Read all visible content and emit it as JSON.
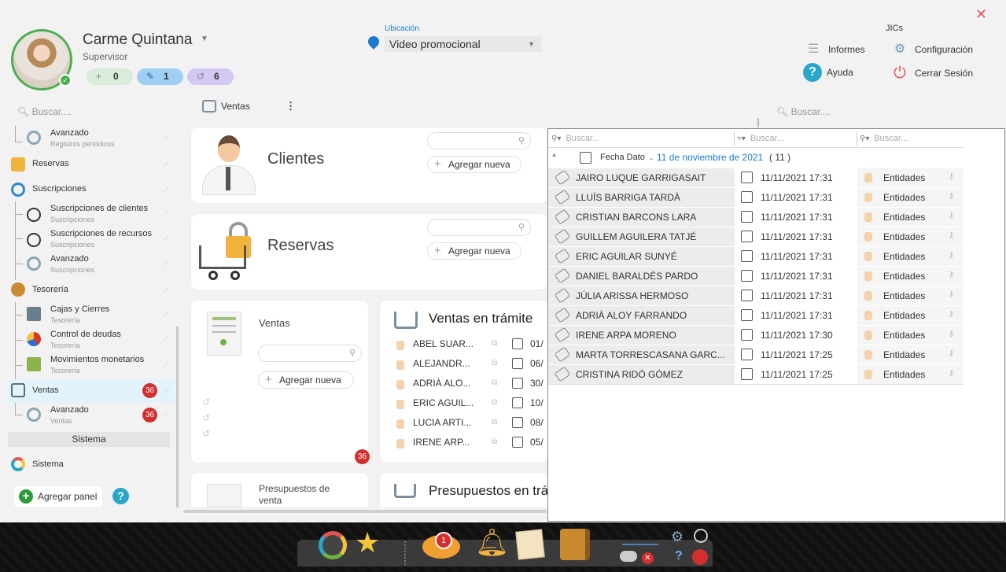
{
  "window": {
    "close_glyph": "✕"
  },
  "user": {
    "name": "Carme Quintana",
    "role": "Supervisor",
    "counters": [
      {
        "icon": "plus-icon",
        "value": "0",
        "color": "#d8ecd9"
      },
      {
        "icon": "pencil-icon",
        "value": "1",
        "color": "#9fcff2"
      },
      {
        "icon": "history-icon",
        "value": "6",
        "color": "#d2c8f2"
      }
    ]
  },
  "location": {
    "label": "Ubicación",
    "value": "Video promocional"
  },
  "header": {
    "jics_label": "JICs",
    "buttons": [
      {
        "id": "informes",
        "label": "Informes",
        "icon": "report-icon"
      },
      {
        "id": "configuracion",
        "label": "Configuración",
        "icon": "gear-icon"
      },
      {
        "id": "ayuda",
        "label": "Ayuda",
        "icon": "help-icon"
      },
      {
        "id": "cerrar",
        "label": "Cerrar Sesión",
        "icon": "power-icon"
      }
    ]
  },
  "sidebar": {
    "search_placeholder": "Buscar....",
    "items": [
      {
        "label": "Avanzado",
        "sub": "Registros periódicos",
        "icon": "gear-icon",
        "child": true
      },
      {
        "label": "Reservas",
        "sub": "",
        "icon": "cart-lock-icon",
        "child": false
      },
      {
        "label": "Suscripciones",
        "sub": "",
        "icon": "subscription-icon",
        "child": false
      },
      {
        "label": "Suscripciones de clientes",
        "sub": "Suscripciones",
        "icon": "client-subscription-icon",
        "child": true
      },
      {
        "label": "Suscripciones de recursos",
        "sub": "Suscripciones",
        "icon": "resource-subscription-icon",
        "child": true
      },
      {
        "label": "Avanzado",
        "sub": "Suscripciones",
        "icon": "gear-icon",
        "child": true
      },
      {
        "label": "Tesorería",
        "sub": "",
        "icon": "money-bag-icon",
        "child": false
      },
      {
        "label": "Cajas y Cierres",
        "sub": "Tesorería",
        "icon": "cash-register-icon",
        "child": true
      },
      {
        "label": "Control de deudas",
        "sub": "Tesorería",
        "icon": "pie-chart-icon",
        "child": true
      },
      {
        "label": "Movimientos monetarios",
        "sub": "Tesorería",
        "icon": "money-movement-icon",
        "child": true
      },
      {
        "label": "Ventas",
        "sub": "",
        "icon": "cart-icon",
        "child": false,
        "badge": "36"
      },
      {
        "label": "Avanzado",
        "sub": "Ventas",
        "icon": "gear-icon",
        "child": true,
        "badge": "36"
      }
    ],
    "section_header": "Sistema",
    "sistema_item": "Sistema",
    "add_panel": "Agregar panel",
    "help_glyph": "?"
  },
  "main": {
    "tab_label": "Ventas",
    "kebab": "⋮",
    "cards": {
      "clientes": {
        "title": "Clientes",
        "add_label": "Agregar nueva"
      },
      "reservas": {
        "title": "Reservas",
        "add_label": "Agregar nueva"
      },
      "ventas": {
        "title": "Ventas",
        "add_label": "Agregar nueva",
        "badge": "36"
      },
      "ventas_tramite": {
        "title": "Ventas en trámite",
        "rows": [
          {
            "name": "ABEL SUAR...",
            "date": "01/"
          },
          {
            "name": "ALEJANDR...",
            "date": "06/"
          },
          {
            "name": "ADRIÀ ALO...",
            "date": "30/"
          },
          {
            "name": "ERIC AGUIL...",
            "date": "10/"
          },
          {
            "name": "LUCIA ARTI...",
            "date": "08/"
          },
          {
            "name": "IRENE ARP...",
            "date": "05/"
          }
        ]
      },
      "presupuestos": {
        "title": "Presupuestos de venta"
      },
      "presupuestos_tramite": {
        "title": "Presupuestos en trá"
      }
    },
    "right_search_placeholder": "Buscar...."
  },
  "grid": {
    "filter_placeholders": [
      "Buscar...",
      "Buscar...",
      "Buscar..."
    ],
    "group": {
      "field": "Fecha Dato",
      "dash": "-",
      "date": "11 de noviembre de 2021",
      "count": "( 11 )"
    },
    "rows": [
      {
        "name": "JAIRO LUQUE GARRIGASAIT",
        "date": "11/11/2021 17:31",
        "entity": "Entidades"
      },
      {
        "name": "LLUÍS BARRIGA TARDÀ",
        "date": "11/11/2021 17:31",
        "entity": "Entidades"
      },
      {
        "name": "CRISTIAN BARCONS LARA",
        "date": "11/11/2021 17:31",
        "entity": "Entidades"
      },
      {
        "name": "GUILLEM AGUILERA TATJÉ",
        "date": "11/11/2021 17:31",
        "entity": "Entidades"
      },
      {
        "name": "ERIC AGUILAR SUNYÉ",
        "date": "11/11/2021 17:31",
        "entity": "Entidades"
      },
      {
        "name": "DANIEL BARALDÉS PARDO",
        "date": "11/11/2021 17:31",
        "entity": "Entidades"
      },
      {
        "name": "JÚLIA ARISSA HERMOSO",
        "date": "11/11/2021 17:31",
        "entity": "Entidades"
      },
      {
        "name": "ADRIÀ ALOY FARRANDO",
        "date": "11/11/2021 17:31",
        "entity": "Entidades"
      },
      {
        "name": "IRENE ARPA MORENO",
        "date": "11/11/2021 17:30",
        "entity": "Entidades"
      },
      {
        "name": "MARTA TORRESCASANA GARC...",
        "date": "11/11/2021 17:25",
        "entity": "Entidades"
      },
      {
        "name": "CRISTINA RIDÓ GÓMEZ",
        "date": "11/11/2021 17:25",
        "entity": "Entidades"
      }
    ]
  },
  "taskbar": {
    "icons": [
      "settings-ring-icon",
      "star-icon",
      "chat-icon",
      "bell-icon",
      "note-icon",
      "wallet-icon",
      "status-icon",
      "gear-icon",
      "clock-icon",
      "cloud-icon",
      "error-icon",
      "help-icon",
      "pin-icon"
    ],
    "chat_badge": "1",
    "help_glyph": "?"
  }
}
